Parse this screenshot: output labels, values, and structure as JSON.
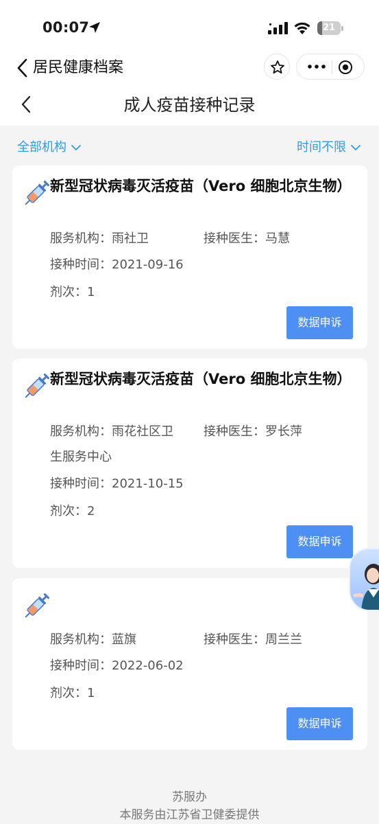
{
  "status_bar": {
    "time": "00:07",
    "battery": "21",
    "battery_level": 0.21
  },
  "mini_header": {
    "title": "居民健康档案"
  },
  "page": {
    "title": "成人疫苗接种记录"
  },
  "filters": {
    "institution": "全部机构",
    "time": "时间不限"
  },
  "labels": {
    "service_org": "服务机构：",
    "doctor": "接种医生：",
    "vac_time": "接种时间：",
    "dose": "剂次："
  },
  "records": [
    {
      "vaccine": "新型冠状病毒灭活疫苗（Vero 细胞北京生物）",
      "org": "雨社卫",
      "doctor": "马慧",
      "time": "2021-09-16",
      "dose": "1",
      "action": "数据申诉"
    },
    {
      "vaccine": "新型冠状病毒灭活疫苗（Vero 细胞北京生物）",
      "org": "雨花社区卫",
      "org_cont": "生服务中心",
      "doctor": "罗长萍",
      "time": "2021-10-15",
      "dose": "2",
      "action": "数据申诉"
    },
    {
      "vaccine": "",
      "org": "蓝旗",
      "doctor": "周兰兰",
      "time": "2022-06-02",
      "dose": "1",
      "action": "数据申诉"
    }
  ],
  "footer": {
    "line1": "苏服办",
    "line2": "本服务由江苏省卫健委提供"
  },
  "colors": {
    "accent": "#2b9de9",
    "button": "#4e8ff4",
    "background": "#f4f4f4"
  },
  "icons": [
    "location-arrow-icon",
    "signal-icon",
    "wifi-icon",
    "battery-icon",
    "back-chevron-icon",
    "star-icon",
    "more-dots-icon",
    "close-circle-icon",
    "chevron-down-icon",
    "syringe-icon",
    "assistant-avatar"
  ]
}
